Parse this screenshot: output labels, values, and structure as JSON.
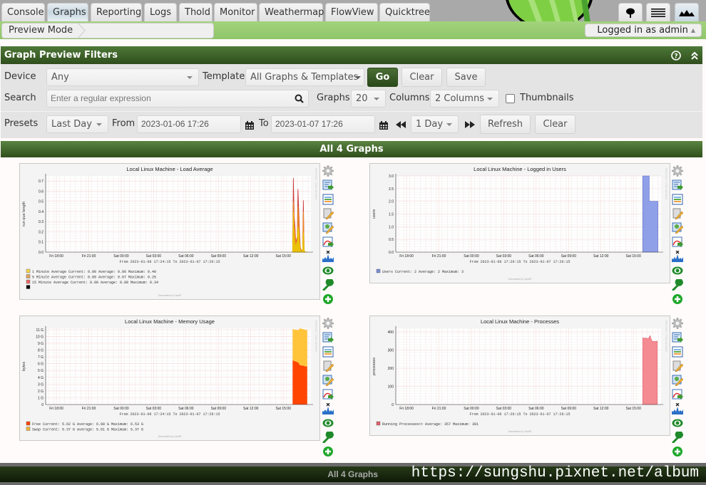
{
  "tabs": [
    {
      "label": "Console",
      "active": false
    },
    {
      "label": "Graphs",
      "active": true
    },
    {
      "label": "Reporting",
      "active": false
    },
    {
      "label": "Logs",
      "active": false
    },
    {
      "label": "Thold",
      "active": false
    },
    {
      "label": "Monitor",
      "active": false
    },
    {
      "label": "Weathermap",
      "active": false
    },
    {
      "label": "FlowView",
      "active": false
    },
    {
      "label": "Quicktree",
      "active": false
    }
  ],
  "nav_icons": [
    "tree-view-icon",
    "list-view-icon",
    "preview-view-icon"
  ],
  "breadcrumb": "Preview Mode",
  "user": {
    "label": "Logged in as admin"
  },
  "filters": {
    "title": "Graph Preview Filters",
    "device_label": "Device",
    "device_value": "Any",
    "template_label": "Template",
    "template_value": "All Graphs & Templates",
    "go": "Go",
    "clear": "Clear",
    "save": "Save",
    "search_label": "Search",
    "search_placeholder": "Enter a regular expression",
    "graphs_label": "Graphs",
    "graphs_value": "20",
    "columns_label": "Columns",
    "columns_value": "2 Columns",
    "thumbnails_label": "Thumbnails",
    "thumbnails_checked": false,
    "presets_label": "Presets",
    "presets_value": "Last Day",
    "from_label": "From",
    "from_value": "2023-01-06 17:26",
    "to_label": "To",
    "to_value": "2023-01-07 17:26",
    "timespan_value": "1 Day",
    "refresh": "Refresh",
    "clear2": "Clear"
  },
  "graphs_header": "All 4 Graphs",
  "graph_icons": [
    "gear-icon",
    "export-graph-icon",
    "data-list-icon",
    "edit-template-icon",
    "edit-device-icon",
    "graph-export-icon",
    "realtime-icon",
    "view-icon",
    "wrench-icon",
    "add-icon"
  ],
  "chart_data": [
    {
      "type": "area",
      "title": "Local Linux Machine - Load Average",
      "ylabel": "run que length",
      "ylim": [
        0,
        0.75
      ],
      "yticks": [
        "0.0",
        "0.1",
        "0.2",
        "0.3",
        "0.4",
        "0.5",
        "0.6",
        "0.7"
      ],
      "ytick_values": [
        0,
        0.1,
        0.2,
        0.3,
        0.4,
        0.5,
        0.6,
        0.7
      ],
      "xticks": [
        "Fri 18:00",
        "Fri 21:00",
        "Sat 00:00",
        "Sat 03:00",
        "Sat 06:00",
        "Sat 09:00",
        "Sat 12:00",
        "Sat 15:00"
      ],
      "range_text": "From 2023-01-06 17:24:15 To 2023-01-07 17:26:15",
      "x_hours": [
        0,
        1.0,
        1.1,
        1.2,
        1.3,
        1.4,
        1.5,
        1.6,
        1.7,
        1.8,
        1.9,
        2.0,
        2.1,
        2.2,
        2.3,
        2.4,
        2.5,
        2.6,
        2.7,
        2.8
      ],
      "series": [
        {
          "name": "15 Minute Average",
          "color": "#cc3333",
          "values": [
            0,
            0.73,
            0.35,
            0.26,
            0.12,
            0.12,
            0.15,
            0.62,
            0.4,
            0.2,
            0.05,
            0.02,
            0.02,
            0.02,
            0.51,
            0.02,
            0,
            0,
            0,
            0
          ]
        },
        {
          "name": "5 Minute Average",
          "color": "#ee8a22",
          "values": [
            0,
            0.5,
            0.25,
            0.2,
            0.1,
            0.1,
            0.12,
            0.45,
            0.3,
            0.12,
            0.04,
            0.02,
            0.02,
            0.02,
            0.4,
            0.02,
            0,
            0,
            0,
            0
          ]
        },
        {
          "name": "1 Minute Average",
          "color": "#eacc00",
          "values": [
            0,
            0.4,
            0.15,
            0.08,
            0.06,
            0.08,
            0.1,
            0.25,
            0.2,
            0.08,
            0.02,
            0.01,
            0.01,
            0.01,
            0.2,
            0.01,
            0,
            0,
            0,
            0
          ]
        }
      ],
      "legend": [
        {
          "name": "1 Minute Average",
          "color": "#f2d54e",
          "current": "0.00",
          "average": "0.06",
          "maximum": "0.40"
        },
        {
          "name": "5 Minute Average",
          "color": "#e0a45c",
          "current": "0.00",
          "average": "0.07",
          "maximum": "0.25"
        },
        {
          "name": "15 Minute Average",
          "color": "#e86a6a",
          "current": "0.00",
          "average": "0.08",
          "maximum": "0.34"
        },
        {
          "name": "",
          "color": "#000000"
        }
      ],
      "footer": "Generated by Cacti®"
    },
    {
      "type": "area",
      "title": "Local Linux Machine - Logged in Users",
      "ylabel": "users",
      "ylim": [
        0,
        3.0
      ],
      "yticks": [
        "0.0",
        "0.5",
        "1.0",
        "1.5",
        "2.0",
        "2.5",
        "3.0"
      ],
      "ytick_values": [
        0,
        0.5,
        1,
        1.5,
        2,
        2.5,
        3
      ],
      "xticks": [
        "Fri 18:00",
        "Fri 21:00",
        "Sat 00:00",
        "Sat 03:00",
        "Sat 06:00",
        "Sat 09:00",
        "Sat 12:00",
        "Sat 15:00"
      ],
      "range_text": "From 2023-01-06 17:26:15 To 2023-01-07 17:26:15",
      "series": [
        {
          "name": "Users",
          "color": "#8fa0e8",
          "steps": [
            [
              22.6,
              3
            ],
            [
              23.2,
              2
            ],
            [
              24,
              2
            ]
          ]
        }
      ],
      "legend": [
        {
          "name": "Users",
          "color": "#7a8ed8",
          "current": "2",
          "average": "2",
          "maximum": "3"
        }
      ],
      "footer": "Generated by Cacti®"
    },
    {
      "type": "stacked-area",
      "title": "Local Linux Machine - Memory Usage",
      "ylabel": "bytes",
      "ylim": [
        0,
        11.2
      ],
      "yticks": [
        "0",
        "1 G",
        "2 G",
        "3 G",
        "4 G",
        "5 G",
        "6 G",
        "7 G",
        "8 G",
        "9 G",
        "10 G",
        "11 G"
      ],
      "ytick_values": [
        0,
        1,
        2,
        3,
        4,
        5,
        6,
        7,
        8,
        9,
        10,
        11
      ],
      "xticks": [
        "Fri 18:00",
        "Fri 21:00",
        "Sat 00:00",
        "Sat 03:00",
        "Sat 06:00",
        "Sat 09:00",
        "Sat 12:00",
        "Sat 15:00"
      ],
      "range_text": "From 2023-01-06 17:24:15 To 2023-01-07 17:26:15",
      "series": [
        {
          "name": "Free",
          "color": "#ff4500",
          "values": [
            6.5,
            6.4,
            6.3,
            6.2,
            5.8,
            5.75,
            5.7,
            5.6,
            5.6
          ]
        },
        {
          "name": "Swap",
          "color": "#ffc43a",
          "values": [
            4.6,
            4.6,
            4.7,
            4.7,
            5.4,
            5.37,
            5.37,
            5.37,
            5.37
          ]
        }
      ],
      "legend": [
        {
          "name": "Free",
          "color": "#ff4500",
          "current": "5.62 G",
          "average": "6.00 G",
          "maximum": "6.53 G"
        },
        {
          "name": "Swap",
          "color": "#f2b43a",
          "current": "5.37 G",
          "average": "5.01 G",
          "maximum": "5.37 G"
        }
      ],
      "footer": "Generated by Cacti®"
    },
    {
      "type": "area",
      "title": "Local Linux Machine - Processes",
      "ylabel": "processes",
      "ylim": [
        0,
        420
      ],
      "yticks": [
        "0",
        "100",
        "200",
        "300",
        "400"
      ],
      "ytick_values": [
        0,
        100,
        200,
        300,
        400
      ],
      "xticks": [
        "Fri 18:00",
        "Fri 21:00",
        "Sat 00:00",
        "Sat 03:00",
        "Sat 06:00",
        "Sat 09:00",
        "Sat 12:00",
        "Sat 15:00"
      ],
      "range_text": "From 2023-01-06 17:26:15 To 2023-01-07 17:26:15",
      "series": [
        {
          "name": "Running Processes<>",
          "color": "#f48a92",
          "values": [
            368,
            366,
            367,
            362,
            381,
            350,
            348,
            348,
            350
          ]
        }
      ],
      "legend": [
        {
          "name": "Running Processes<>",
          "color": "#e0606a",
          "average": "357",
          "maximum": "381"
        }
      ],
      "footer": "Generated by Cacti®"
    }
  ],
  "footer": {
    "label": "All 4 Graphs",
    "watermark": "https://sungshu.pixnet.net/album"
  }
}
